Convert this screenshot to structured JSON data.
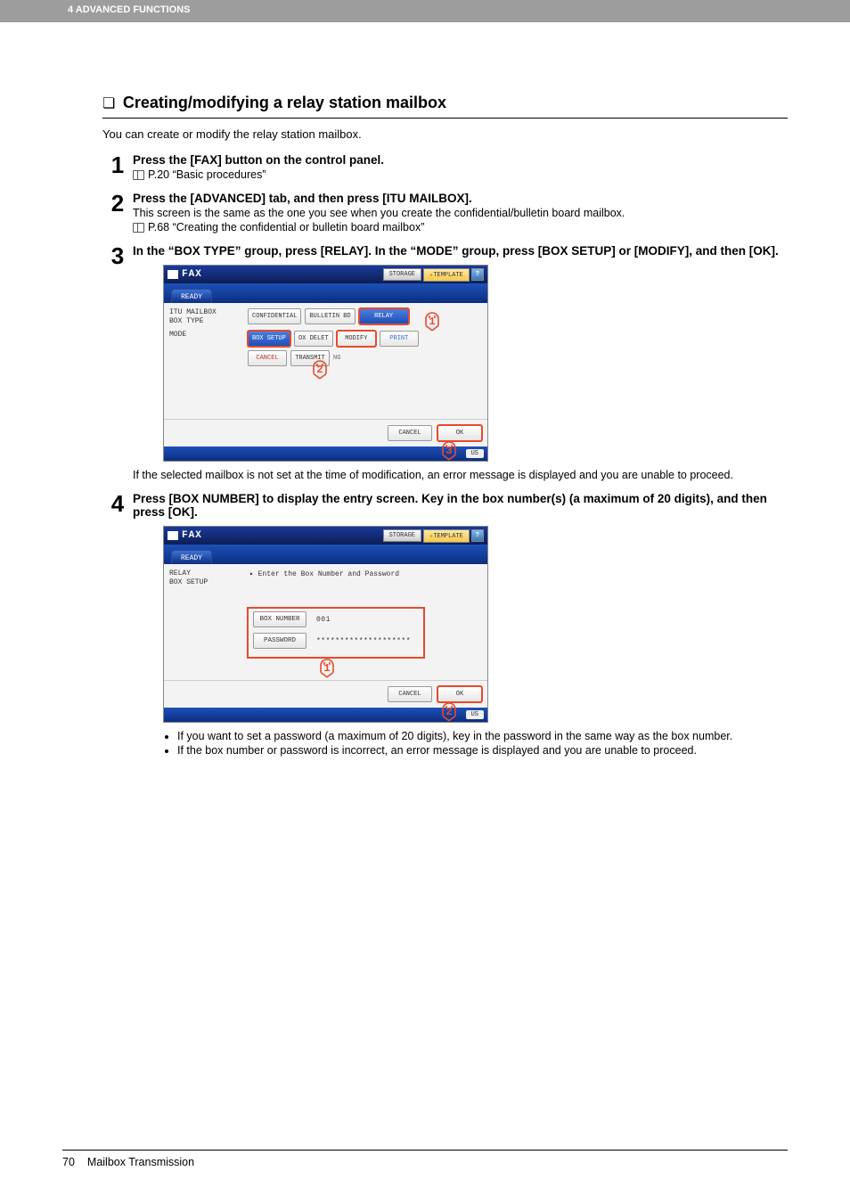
{
  "header": {
    "breadcrumb": "4 ADVANCED FUNCTIONS"
  },
  "section": {
    "title": "Creating/modifying a relay station mailbox",
    "intro": "You can create or modify the relay station mailbox."
  },
  "steps": {
    "s1": {
      "num": "1",
      "title": "Press the [FAX] button on the control panel.",
      "ref": "P.20 “Basic procedures”"
    },
    "s2": {
      "num": "2",
      "title": "Press the [ADVANCED] tab, and then press [ITU MAILBOX].",
      "desc": "This screen is the same as the one you see when you create the confidential/bulletin board mailbox.",
      "ref": "P.68 “Creating the confidential or bulletin board mailbox”"
    },
    "s3": {
      "num": "3",
      "title": "In the “BOX TYPE” group, press [RELAY]. In the “MODE” group, press [BOX SETUP] or [MODIFY], and then [OK].",
      "note": "If the selected mailbox is not set at the time of modification, an error message is displayed and you are unable to proceed."
    },
    "s4": {
      "num": "4",
      "title": "Press [BOX NUMBER] to display the entry screen. Key in the box number(s) (a maximum of 20 digits), and then press [OK].",
      "bullets": [
        "If you want to set a password (a maximum of 20 digits), key in the password in the same way as the box number.",
        "If the box number or password is incorrect, an error message is displayed and you are unable to proceed."
      ]
    }
  },
  "panel": {
    "title": "FAX",
    "storage": "STORAGE",
    "template": "TEMPLATE",
    "ready": "READY",
    "s3": {
      "left1a": "ITU MAILBOX",
      "left1b": "BOX TYPE",
      "left2": "MODE",
      "confidential": "CONFIDENTIAL",
      "bulletin": "BULLETIN BD",
      "relay": "RELAY",
      "boxsetup": "BOX SETUP",
      "boxdelete": "OX DELET",
      "modify": "MODIFY",
      "print": "PRINT",
      "cancel": "CANCEL",
      "transmit": "TRANSMIT",
      "ng": "NG"
    },
    "s4": {
      "left1a": "RELAY",
      "left1b": "BOX SETUP",
      "prompt": "▸ Enter the Box Number and Password",
      "boxnumber_label": "BOX NUMBER",
      "boxnumber_val": "001",
      "password_label": "PASSWORD",
      "password_val": "********************"
    },
    "cancelbtn": "CANCEL",
    "okbtn": "OK",
    "jobstatus": "US"
  },
  "callouts": {
    "one": "1",
    "two": "2",
    "three": "3"
  },
  "footer": {
    "pagenum": "70",
    "chapter": "Mailbox Transmission"
  }
}
